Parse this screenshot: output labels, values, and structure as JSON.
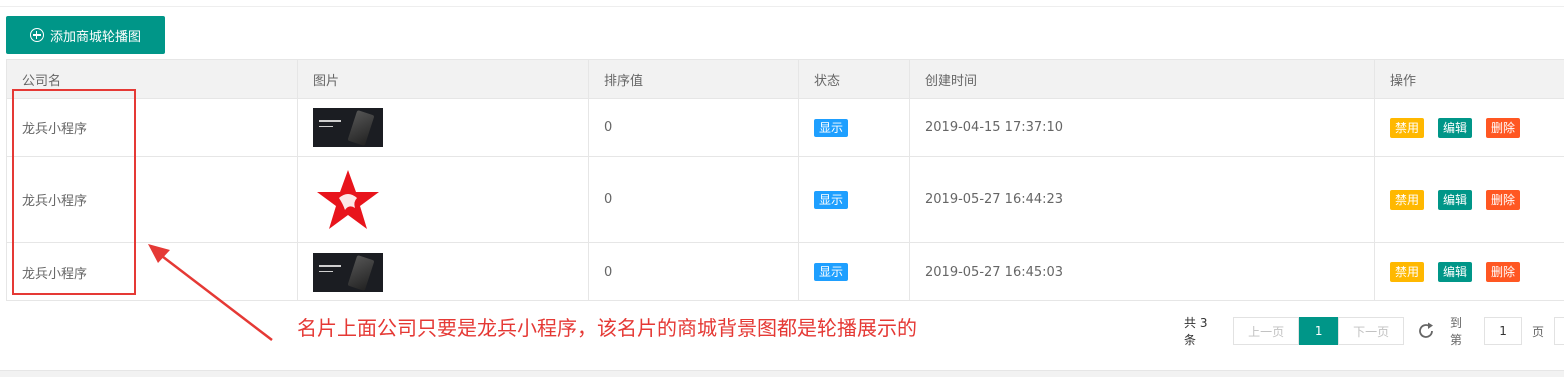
{
  "toolbar": {
    "add_label": "添加商城轮播图"
  },
  "table": {
    "headers": [
      "公司名",
      "图片",
      "排序值",
      "状态",
      "创建时间",
      "操作"
    ],
    "rows": [
      {
        "company": "龙兵小程序",
        "image": "card-photo",
        "sort": "0",
        "status": "显示",
        "created": "2019-04-15 17:37:10"
      },
      {
        "company": "龙兵小程序",
        "image": "red-star-logo",
        "sort": "0",
        "status": "显示",
        "created": "2019-05-27 16:44:23"
      },
      {
        "company": "龙兵小程序",
        "image": "card-photo",
        "sort": "0",
        "status": "显示",
        "created": "2019-05-27 16:45:03"
      }
    ],
    "actions": {
      "disable": "禁用",
      "edit": "编辑",
      "delete": "删除"
    }
  },
  "annotation": {
    "text": "名片上面公司只要是龙兵小程序，该名片的商城背景图都是轮播展示的",
    "color": "#e53935"
  },
  "pagination": {
    "total": "共 3 条",
    "prev": "上一页",
    "current": "1",
    "next": "下一页",
    "goto_label": "到第",
    "page_value": "1",
    "page_unit": "页"
  },
  "colors": {
    "primary": "#009688",
    "show_badge": "#1e9fff",
    "disable": "#ffb800",
    "delete": "#ff5722"
  }
}
